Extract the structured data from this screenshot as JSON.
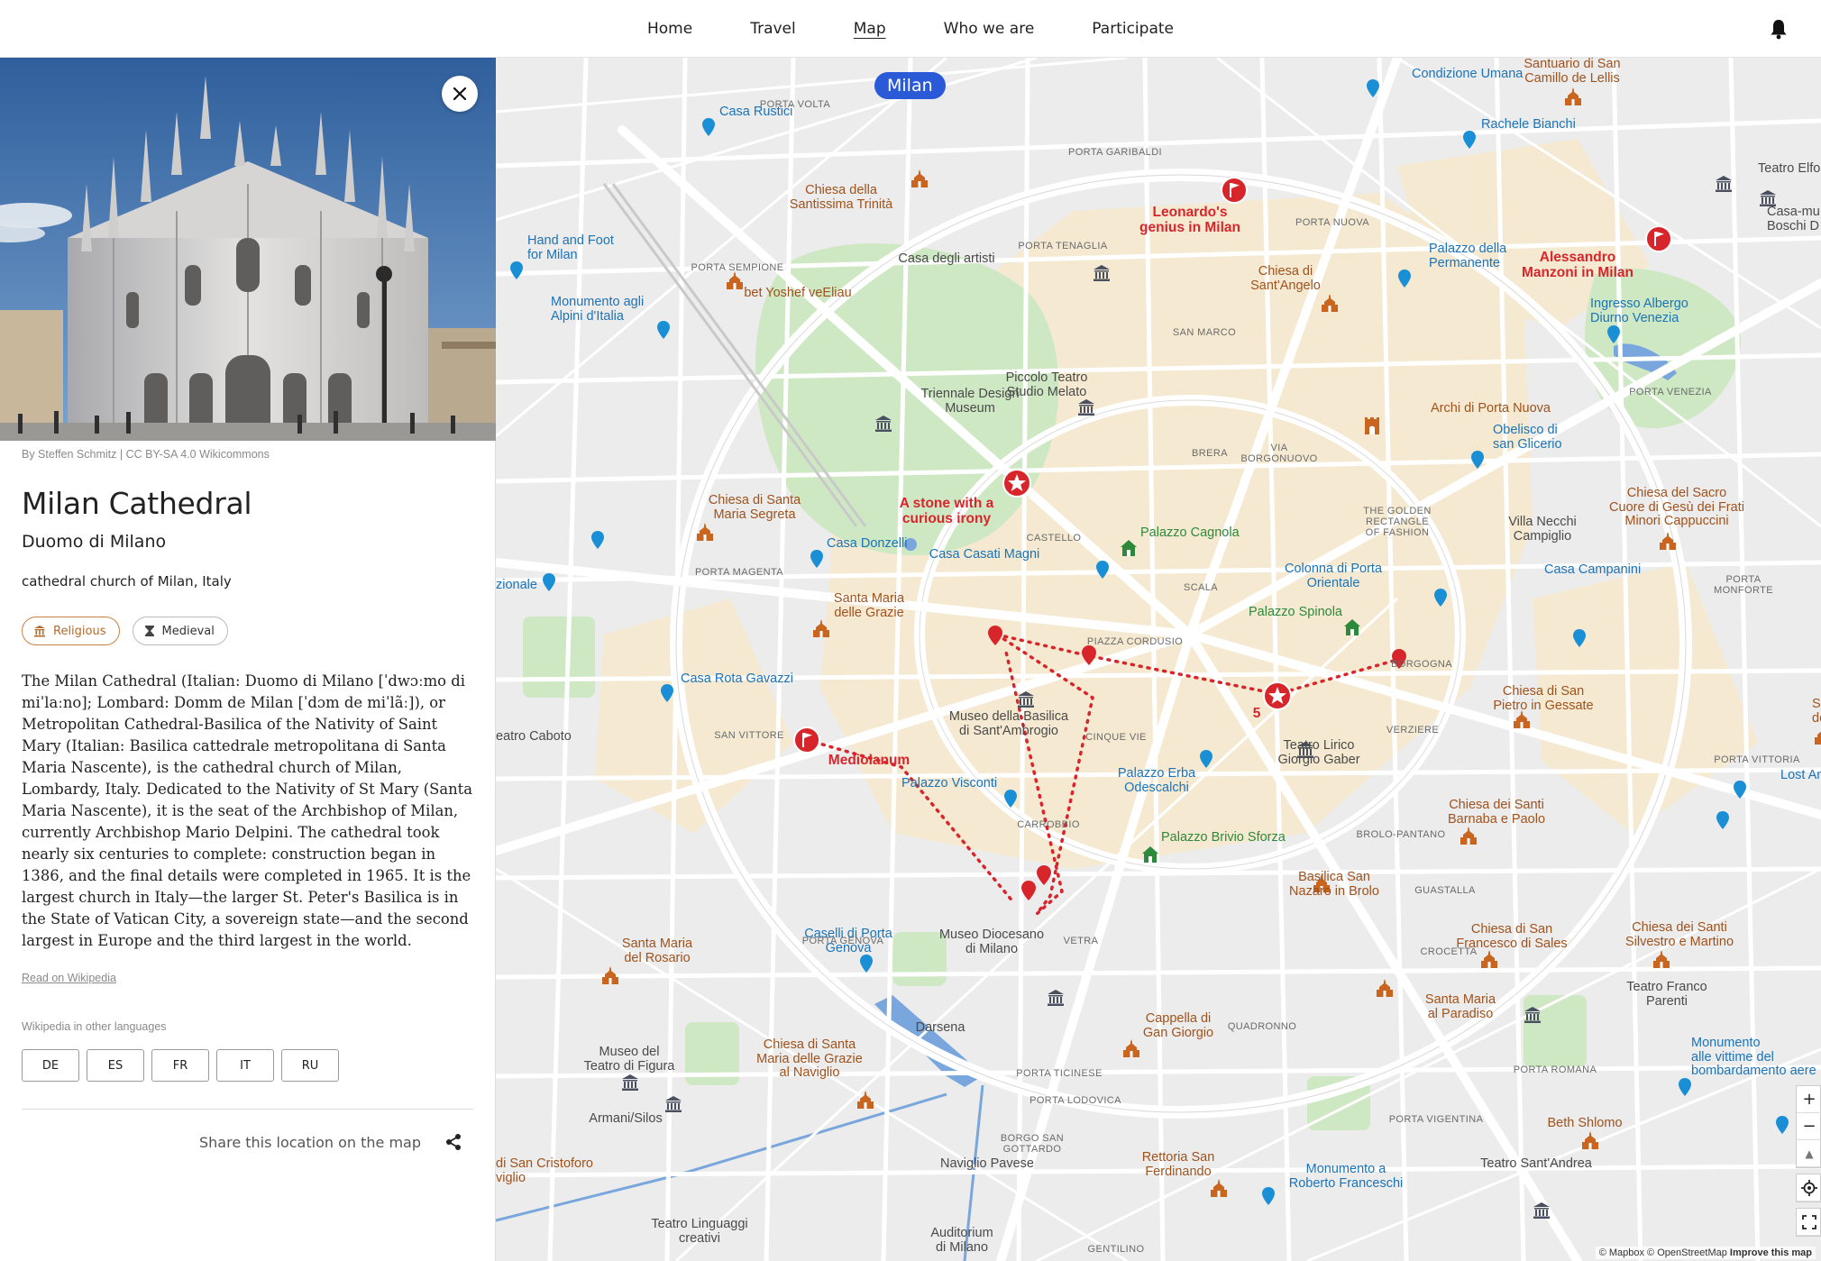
{
  "nav": {
    "items": [
      "Home",
      "Travel",
      "Map",
      "Who we are",
      "Participate"
    ],
    "active": "Map"
  },
  "panel": {
    "image_credit": "By Steffen Schmitz | CC BY-SA 4.0 Wikicommons",
    "title": "Milan Cathedral",
    "subtitle": "Duomo di Milano",
    "short_description": "cathedral church of Milan, Italy",
    "tags": [
      {
        "label": "Religious",
        "icon": "temple-icon",
        "color": "#c98044"
      },
      {
        "label": "Medieval",
        "icon": "hourglass-icon",
        "color": "#555555"
      }
    ],
    "body": "The Milan Cathedral (Italian: Duomo di Milano [ˈdwɔːmo di miˈlaːno]; Lombard: Domm de Milan [ˈdɔm de miˈlãː]), or Metropolitan Cathedral-Basilica of the Nativity of Saint Mary (Italian: Basilica cattedrale metropolitana di Santa Maria Nascente), is the cathedral church of Milan, Lombardy, Italy. Dedicated to the Nativity of St Mary (Santa Maria Nascente), it is the seat of the Archbishop of Milan, currently Archbishop Mario Delpini. The cathedral took nearly six centuries to complete: construction began in 1386, and the final details were completed in 1965. It is the largest church in Italy—the larger St. Peter's Basilica is in the State of Vatican City, a sovereign state—and the second largest in Europe and the third largest in the world.",
    "read_link": "Read on Wikipedia",
    "other_languages_label": "Wikipedia in other languages",
    "languages": [
      "DE",
      "ES",
      "FR",
      "IT",
      "RU"
    ],
    "share_label": "Share this location on the map"
  },
  "map": {
    "city": "Milan",
    "colors": {
      "blue_pin": "#1b8fd6",
      "brown_poi": "#c9651e",
      "red_story": "#d7262b",
      "green_poi": "#2d8a3a",
      "badge": "#2a5ad8"
    },
    "zoom_controls": [
      "+",
      "−",
      "▲"
    ],
    "attribution": "© Mapbox © OpenStreetMap",
    "improve": "Improve this map",
    "story_labels": [
      "Leonardo's\ngenius in Milan",
      "Alessandro\nManzoni in Milan",
      "A stone with a\ncurious irony",
      "Mediolanum",
      "5"
    ],
    "blue_labels": [
      "Casa Rustici",
      "Condizione Umana",
      "Rachele Bianchi",
      "Hand and Foot\nfor Milan",
      "Monumento agli\nAlpini d'Italia",
      "Palazzo della\nPermanente",
      "Ingresso Albergo\nDiurno Venezia",
      "Obelisco di\nsan Glicerio",
      "Casa Donzelli",
      "Casa Casati Magni",
      "Colonna di Porta\nOrientale",
      "Casa Campanini",
      "Casa Rota Gavazzi",
      "Palazzo Visconti",
      "Palazzo Erba\nOdescalchi",
      "Caselli di Porta\nGenova",
      "Monumento\nalle vittime del\nbombardamento aere",
      "Monumento a\nRoberto Franceschi",
      "Lost And Fo",
      "zionale"
    ],
    "brown_labels": [
      "Santuario di San\nCamillo de Lellis",
      "Chiesa della\nSantissima Trinità",
      "bet Yoshef veEliau",
      "Chiesa di\nSant'Angelo",
      "Archi di Porta Nuova",
      "Chiesa di Santa\nMaria Segreta",
      "Chiesa del Sacro\nCuore di Gesù dei Frati\nMinori Cappuccini",
      "Santa Maria\ndelle Grazie",
      "Chiesa di San\nPietro in Gessate",
      "Santa\ndel Su",
      "Chiesa dei Santi\nBarnaba e Paolo",
      "Basilica San\nNazaro in Brolo",
      "Chiesa di San\nFrancesco di Sales",
      "Chiesa dei Santi\nSilvestro e Martino",
      "Santa Maria\ndel Rosario",
      "Santa Maria\nal Paradiso",
      "Cappella di\nGan Giorgio",
      "Chiesa di Santa\nMaria delle Grazie\nal Naviglio",
      "Beth Shlomo",
      "Rettoria San\nFerdinando",
      "di San Cristoforo\nviglio"
    ],
    "green_labels": [
      "Palazzo Cagnola",
      "Palazzo Spinola",
      "Palazzo Brivio Sforza"
    ],
    "dark_labels": [
      "Teatro Elfo Pucc",
      "Casa-mu\nBoschi D",
      "Casa degli artisti",
      "Triennale Design\nMuseum",
      "Piccolo Teatro\nStudio Melato",
      "Villa Necchi\nCampiglio",
      "Museo della Basilica\ndi Sant'Ambrogio",
      "Teatro Lirico\nGiorgio Gaber",
      "Museo Diocesano\ndi Milano",
      "Teatro Franco\nParenti",
      "Museo del\nTeatro di Figura",
      "Armani/Silos",
      "Teatro Sant'Andrea",
      "Teatro Linguaggi\ncreativi",
      "Auditorium\ndi Milano",
      "eatro Caboto",
      "Darsena",
      "Naviglio Pavese"
    ],
    "district_labels": [
      "PORTA VOLTA",
      "PORTA GARIBALDI",
      "PORTA NUOVA",
      "PORTA TENAGLIA",
      "PORTA SEMPIONE",
      "SAN MARCO",
      "PORTA VENEZIA",
      "BRERA",
      "VIA\nBORGONUOVO",
      "THE GOLDEN\nRECTANGLE\nOF FASHION",
      "CASTELLO",
      "PORTA MAGENTA",
      "SCALA",
      "PORTA\nMONFORTE",
      "PIAZZA CORDUSIO",
      "BORGOGNA",
      "SAN VITTORE",
      "CINQUE VIE",
      "VERZIERE",
      "PORTA VITTORIA",
      "CARROBBIO",
      "BROLO-PANTANO",
      "GUASTALLA",
      "PORTA GENOVA",
      "VETRA",
      "CROCETTA",
      "QUADRONNO",
      "PORTA TICINESE",
      "PORTA LODOVICA",
      "PORTA VIGENTINA",
      "PORTA ROMANA",
      "BORGO SAN\nGOTTARDO",
      "GENTILINO"
    ]
  }
}
